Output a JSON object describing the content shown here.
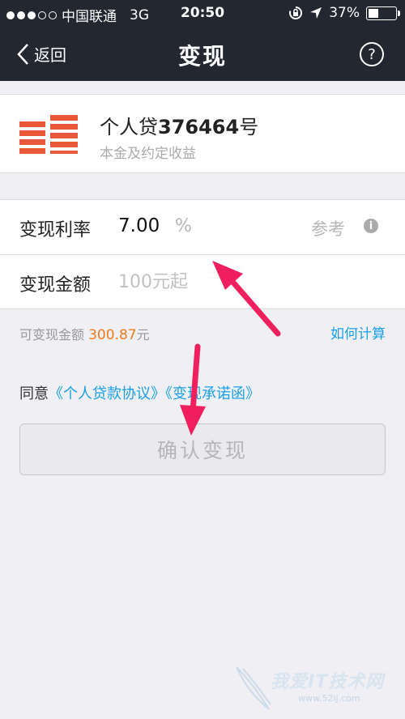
{
  "status_bar": {
    "carrier": "中国联通",
    "network": "3G",
    "time": "20:50",
    "battery_text": "37%",
    "battery_level": 0.37
  },
  "nav": {
    "back_label": "返回",
    "title": "变现",
    "help_glyph": "?"
  },
  "product": {
    "name_prefix": "个人贷",
    "name_number": "376464",
    "name_suffix": "号",
    "subtitle": "本金及约定收益",
    "icon": "product-bars-icon",
    "icon_color": "#e8573a"
  },
  "form": {
    "rate": {
      "label": "变现利率",
      "value": "7.00",
      "unit": "%",
      "ref_label": "参考",
      "info_glyph": "i"
    },
    "amount": {
      "label": "变现金额",
      "placeholder": "100元起",
      "value": ""
    }
  },
  "available": {
    "label": "可变现金额",
    "amount": "300.87",
    "unit": "元",
    "calc_link": "如何计算"
  },
  "agreement": {
    "prefix": "同意",
    "link1": "《个人贷款协议》",
    "link2": "《变现承诺函》"
  },
  "confirm_button": {
    "label": "确认变现"
  },
  "colors": {
    "nav_bg": "#232730",
    "accent_link": "#1aa0e6",
    "amount_orange": "#f07a1e",
    "annotation_pink": "#f0205e"
  },
  "watermark": {
    "text": "我爱IT技术网",
    "url": "www.52ij.com"
  }
}
